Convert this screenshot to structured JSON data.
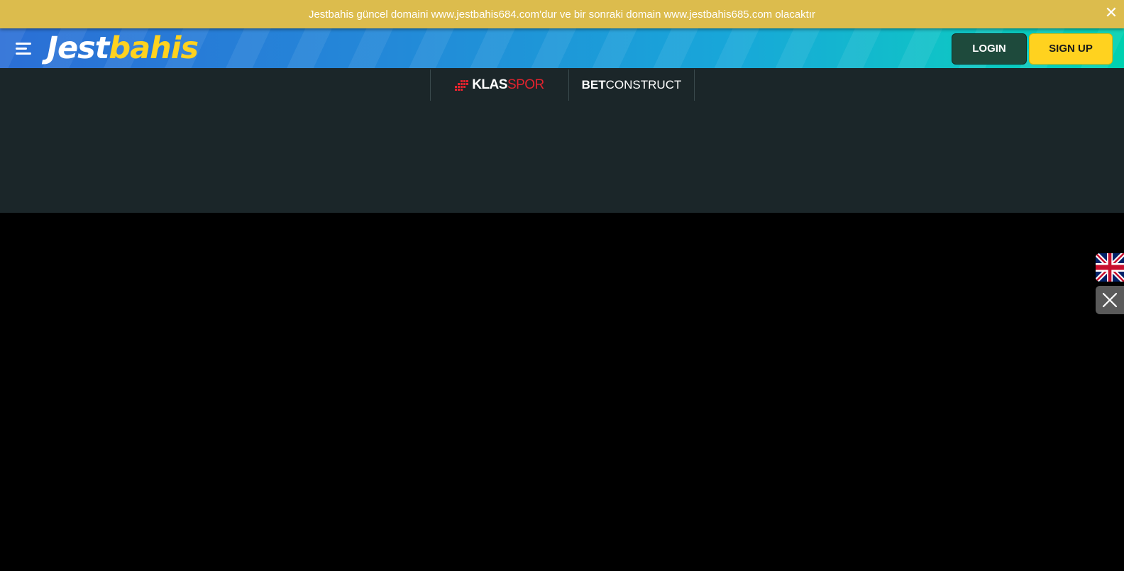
{
  "notice": {
    "text": "Jestbahis güncel domaini www.jestbahis684.com'dur ve bir sonraki domain www.jestbahis685.com olacaktır",
    "close_glyph": "✕"
  },
  "header": {
    "logo_part1": "Jest",
    "logo_part2": "bahis",
    "login_label": "LOGIN",
    "signup_label": "SIGN UP",
    "brand_yellow": "#ffd21f",
    "login_bg": "#1e4a3c"
  },
  "partners": {
    "klas_bold": "KLAS",
    "klas_light": "SPOR",
    "bet_bold": "BET",
    "bet_light": "CONSTRUCT"
  },
  "floating": {
    "language_flag": "uk-flag-icon",
    "close_icon": "close-icon"
  },
  "colors": {
    "notice_bg": "#dcbc4d",
    "partners_bg": "#1b2629",
    "page_bg": "#000000"
  }
}
